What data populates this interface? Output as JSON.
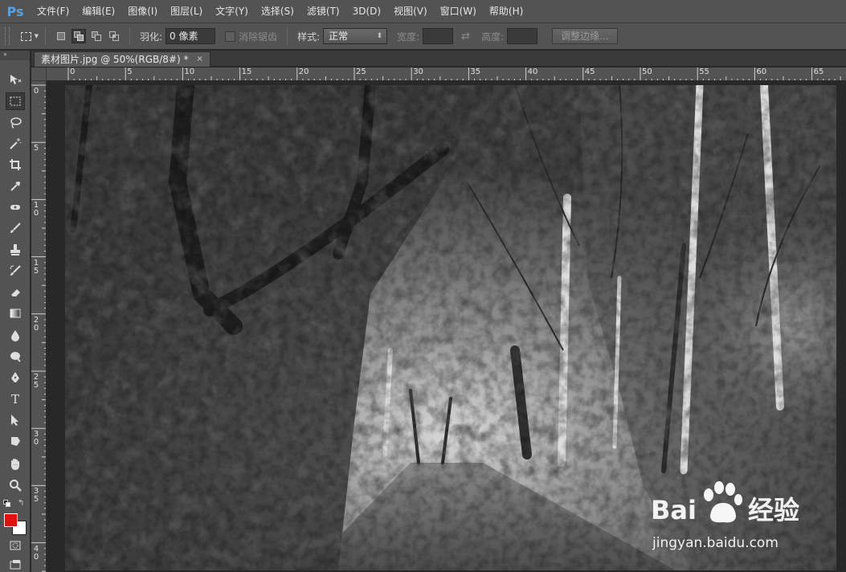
{
  "app": {
    "logo": "Ps"
  },
  "menu": [
    "文件(F)",
    "编辑(E)",
    "图像(I)",
    "图层(L)",
    "文字(Y)",
    "选择(S)",
    "滤镜(T)",
    "3D(D)",
    "视图(V)",
    "窗口(W)",
    "帮助(H)"
  ],
  "options": {
    "feather_label": "羽化:",
    "feather_value": "0 像素",
    "antialias_label": "消除锯齿",
    "style_label": "样式:",
    "style_value": "正常",
    "width_label": "宽度:",
    "height_label": "高度:",
    "refine_edge_button": "调整边缘..."
  },
  "document": {
    "tab_title": "素材图片.jpg @ 50%(RGB/8#) *",
    "close_glyph": "×"
  },
  "rulers": {
    "top_labels": [
      "0",
      "5",
      "10",
      "15",
      "20",
      "25",
      "30",
      "35",
      "40",
      "45",
      "50",
      "55",
      "60",
      "65"
    ],
    "left_labels": [
      "0",
      "5",
      "1 0",
      "1 5",
      "2 0",
      "2 5",
      "3 0",
      "3 5",
      "4 0"
    ]
  },
  "colors": {
    "foreground": "#e01010",
    "background": "#ffffff",
    "ui_panel": "#535353",
    "workspace": "#282828"
  },
  "tools": [
    "move-tool-icon",
    "marquee-tool-icon",
    "lasso-tool-icon",
    "magic-wand-icon",
    "crop-tool-icon",
    "eyedropper-icon",
    "healing-brush-icon",
    "brush-tool-icon",
    "clone-stamp-icon",
    "history-brush-icon",
    "eraser-icon",
    "gradient-tool-icon",
    "blur-tool-icon",
    "dodge-tool-icon",
    "pen-tool-icon",
    "type-tool-icon",
    "path-selection-icon",
    "shape-tool-icon",
    "hand-tool-icon",
    "zoom-tool-icon",
    "quick-mask-icon",
    "screen-mode-icon"
  ],
  "watermark": {
    "logo_text_left": "Bai",
    "logo_text_right": "经验",
    "url": "jingyan.baidu.com"
  }
}
